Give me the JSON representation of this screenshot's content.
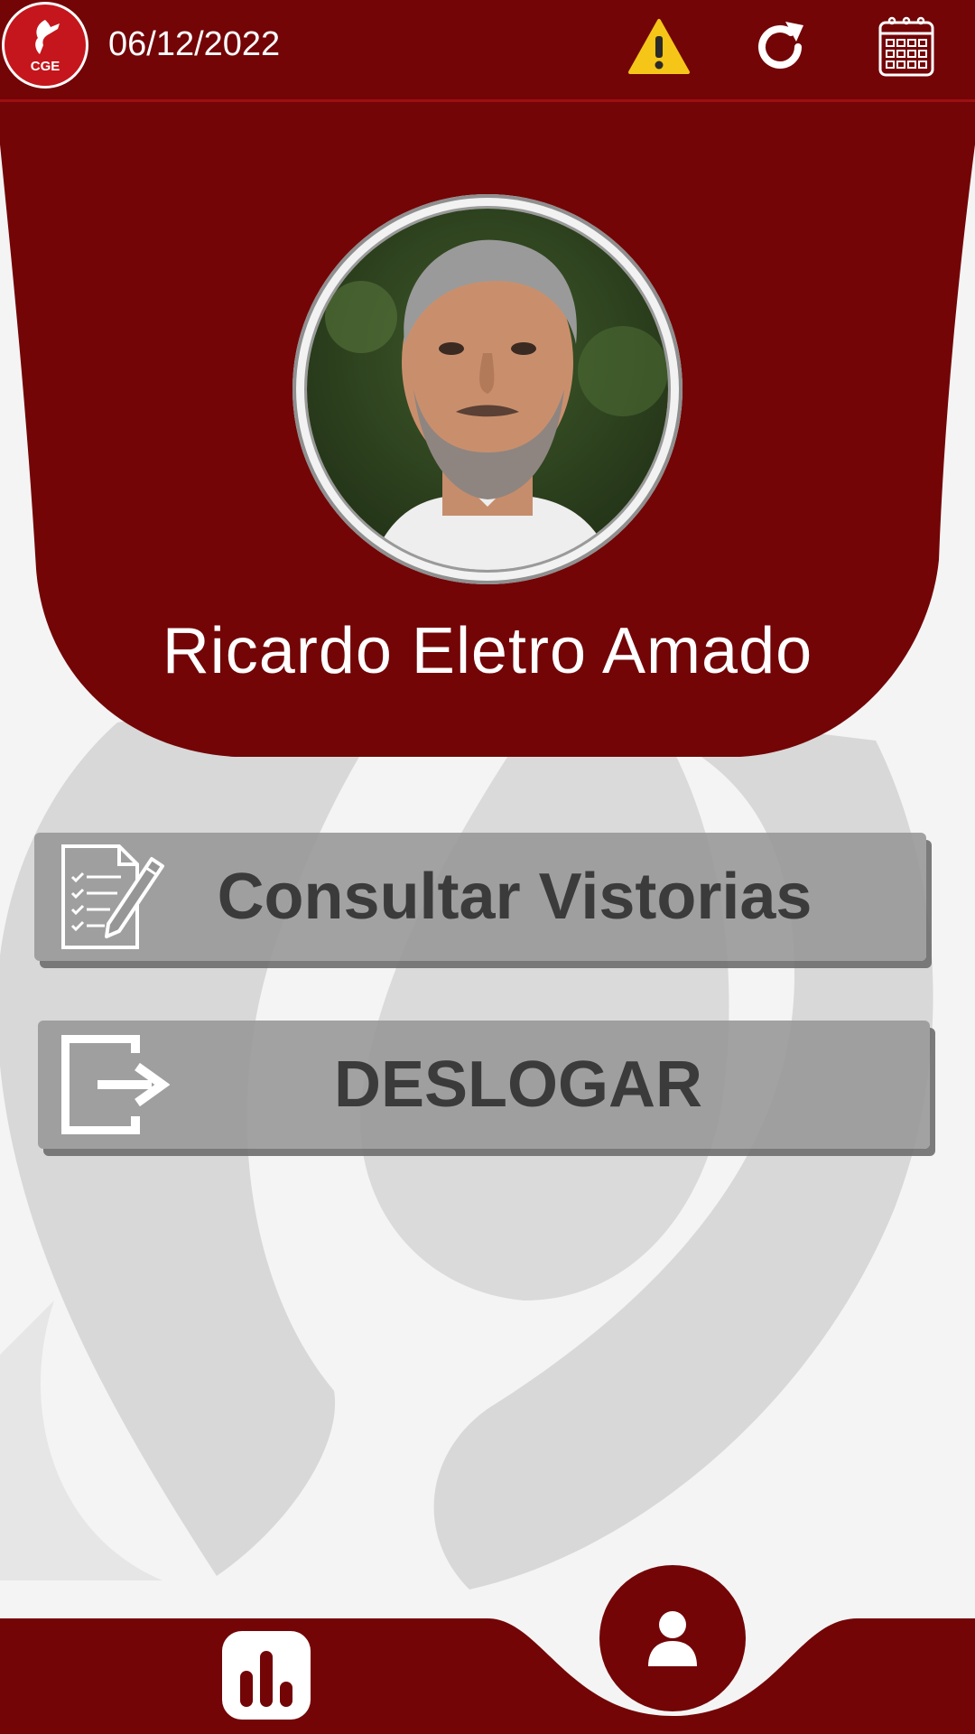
{
  "header": {
    "logo_text": "CGE",
    "date": "06/12/2022"
  },
  "icons": {
    "warning": "warning-icon",
    "refresh": "refresh-icon",
    "calendar": "calendar-icon",
    "stats": "bar-chart-icon",
    "profile": "user-icon"
  },
  "profile": {
    "name": "Ricardo Eletro Amado"
  },
  "actions": {
    "consult_label": "Consultar Vistorias",
    "logout_label": "DESLOGAR"
  },
  "colors": {
    "brand": "#730507",
    "warning": "#f5c518",
    "button": "#969696",
    "button_text": "#3b3b3b"
  }
}
